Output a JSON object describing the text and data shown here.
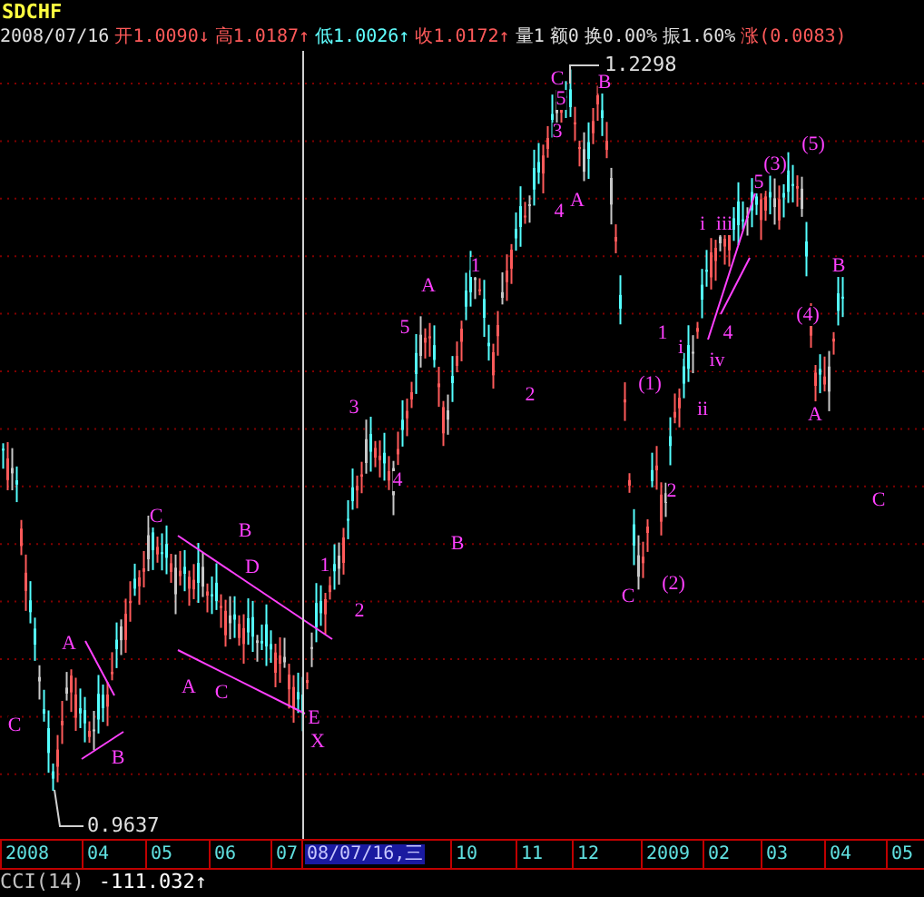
{
  "symbol": "SDCHF",
  "quote": [
    {
      "kind": "date",
      "text": "2008/07/16"
    },
    {
      "kind": "rise",
      "text": "开1.0090↓"
    },
    {
      "kind": "rise",
      "text": "高1.0187↑"
    },
    {
      "kind": "fall",
      "text": "低1.0026↑"
    },
    {
      "kind": "rise",
      "text": "收1.0172↑"
    },
    {
      "kind": "plain",
      "text": "量1"
    },
    {
      "kind": "plain",
      "text": "额0"
    },
    {
      "kind": "plain",
      "text": "换0.00%"
    },
    {
      "kind": "plain",
      "text": "振1.60%"
    },
    {
      "kind": "rise",
      "text": "涨(0.0083)"
    }
  ],
  "chart": {
    "wave_labels": [
      "C",
      "B",
      "5",
      "3",
      "(5)",
      "(3)",
      "5",
      "A",
      "4",
      "i",
      "iii",
      "1",
      "B",
      "A",
      "(4)",
      "5",
      "1",
      "4",
      "i",
      "iv",
      "(1)",
      "2",
      "3",
      "ii",
      "A",
      "4",
      "2",
      "C",
      "C",
      "B",
      "B",
      "1",
      "D",
      "(2)",
      "C",
      "2",
      "A",
      "A",
      "C",
      "E",
      "C",
      "X",
      "B"
    ],
    "price_marks": [
      {
        "kind": "high",
        "text": "1.2298"
      },
      {
        "kind": "low",
        "text": "0.9637"
      }
    ]
  },
  "time_axis": [
    {
      "text": "2008",
      "selected": false
    },
    {
      "text": "04",
      "selected": false
    },
    {
      "text": "05",
      "selected": false
    },
    {
      "text": "06",
      "selected": false
    },
    {
      "text": "07",
      "selected": false
    },
    {
      "text": "08/07/16,三",
      "selected": true
    },
    {
      "text": "10",
      "selected": false
    },
    {
      "text": "11",
      "selected": false
    },
    {
      "text": "12",
      "selected": false
    },
    {
      "text": "2009",
      "selected": false
    },
    {
      "text": "02",
      "selected": false
    },
    {
      "text": "03",
      "selected": false
    },
    {
      "text": "04",
      "selected": false
    },
    {
      "text": "05",
      "selected": false
    }
  ],
  "indicator": {
    "name": "CCI(14)",
    "value": "-111.032↑"
  }
}
